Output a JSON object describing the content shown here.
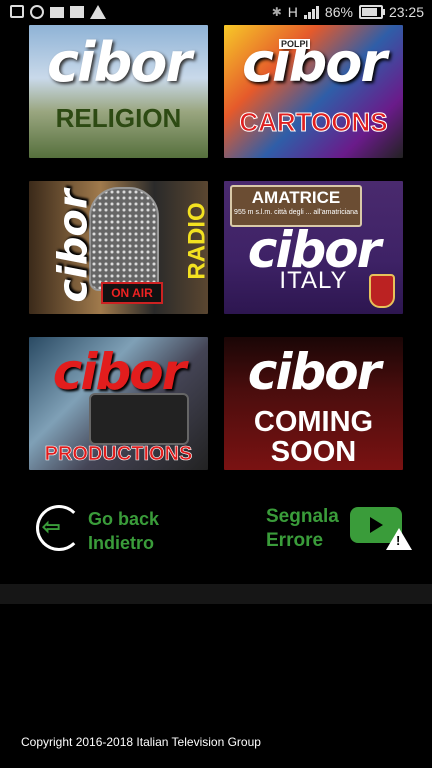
{
  "statusbar": {
    "icons": [
      "message-icon",
      "whatsapp-icon",
      "mail-icon",
      "image-icon",
      "warning-icon"
    ],
    "network": "H",
    "battery_percent": "86%",
    "battery_level": 0.86,
    "time": "23:25"
  },
  "tiles": [
    {
      "logo": "cibor",
      "label": "RELIGION"
    },
    {
      "logo": "cibor",
      "label": "CARTOONS",
      "badge": "POLPI"
    },
    {
      "logo": "cibor",
      "label": "RADIO",
      "badge": "ON AIR"
    },
    {
      "logo": "cibor",
      "label": "ITALY",
      "sign_title": "AMATRICE",
      "sign_subtitle": "955 m s.l.m. città degli ... all'amatriciana"
    },
    {
      "logo": "cibor",
      "label": "PRODUCTIONS"
    },
    {
      "logo": "cibor",
      "label_line1": "COMING",
      "label_line2": "SOON"
    }
  ],
  "back": {
    "line1": "Go back",
    "line2": "Indietro"
  },
  "report": {
    "line1": "Segnala",
    "line2": "Errore"
  },
  "footer": {
    "copyright": "Copyright 2016-2018 Italian Television Group"
  },
  "colors": {
    "accent_green": "#3a9c3a",
    "background": "#000000"
  }
}
